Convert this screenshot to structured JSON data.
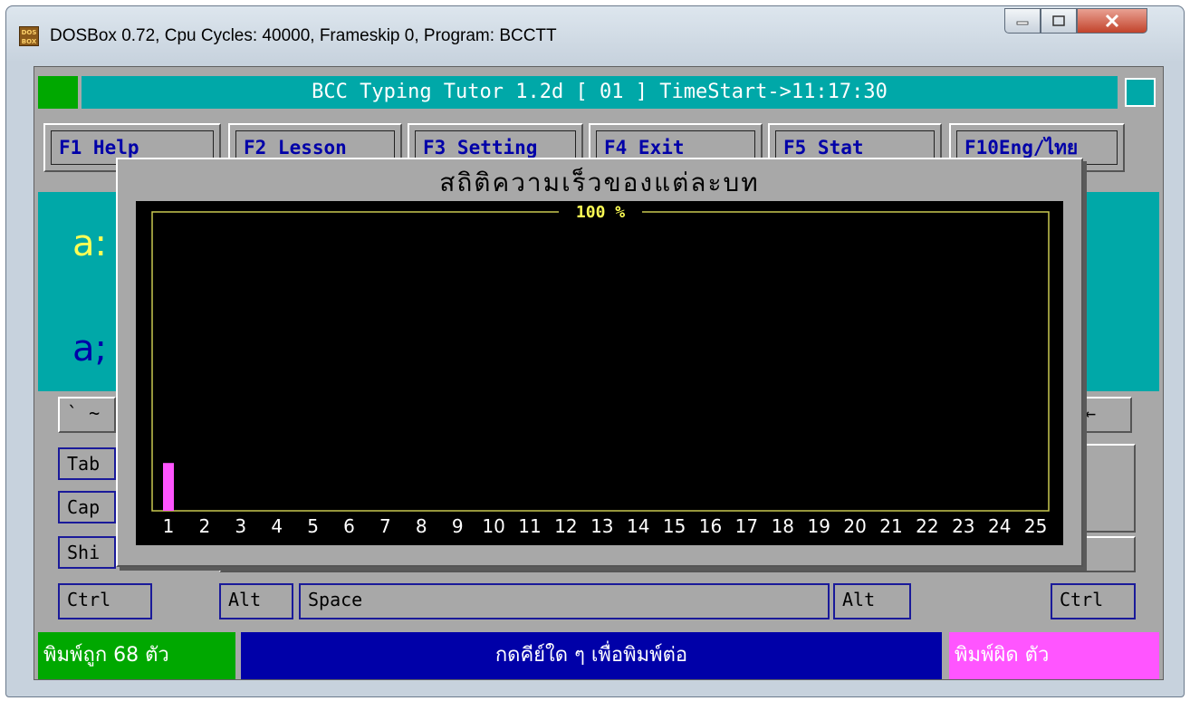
{
  "window": {
    "title": "DOSBox 0.72, Cpu Cycles:    40000, Frameskip  0, Program:    BCCTT",
    "icon": "dosbox-icon",
    "icon_text": "DOS BOX"
  },
  "app": {
    "header": "BCC Typing Tutor 1.2d [ 01 ] TimeStart->11:17:30"
  },
  "function_keys": [
    "F1 Help",
    "F2 Lesson",
    "F3 Setting",
    "F4  Exit",
    "F5 Stat",
    "F10Eng/ไทย"
  ],
  "lesson": {
    "line1": "a:",
    "line2": "a;"
  },
  "keyboard": {
    "row1_left": "` ~",
    "row1_right": "←",
    "tab": "Tab",
    "caps": "Cap",
    "shift": "Shi",
    "ctrl_left": "Ctrl",
    "alt_left": "Alt",
    "space": "Space",
    "alt_right": "Alt",
    "ctrl_right": "Ctrl"
  },
  "status": {
    "correct": "พิมพ์ถูก 68    ตัว",
    "prompt": "กดคีย์ใด ๆ  เพื่อพิมพ์ต่อ",
    "wrong": "พิมพ์ผิด            ตัว"
  },
  "dialog": {
    "title": "สถิติความเร็วของแต่ละบท",
    "colors": {
      "bar": "#ff55ff",
      "frame": "#c8c850",
      "label": "#ffffff",
      "max_label": "#ffff55",
      "background": "#000000"
    }
  },
  "chart_data": {
    "type": "bar",
    "title": "สถิติความเร็วของแต่ละบท",
    "max_label": "100 %",
    "categories": [
      "1",
      "2",
      "3",
      "4",
      "5",
      "6",
      "7",
      "8",
      "9",
      "10",
      "11",
      "12",
      "13",
      "14",
      "15",
      "16",
      "17",
      "18",
      "19",
      "20",
      "21",
      "22",
      "23",
      "24",
      "25"
    ],
    "values": [
      16,
      0,
      0,
      0,
      0,
      0,
      0,
      0,
      0,
      0,
      0,
      0,
      0,
      0,
      0,
      0,
      0,
      0,
      0,
      0,
      0,
      0,
      0,
      0,
      0
    ],
    "ylim": [
      0,
      100
    ],
    "grid": false
  }
}
